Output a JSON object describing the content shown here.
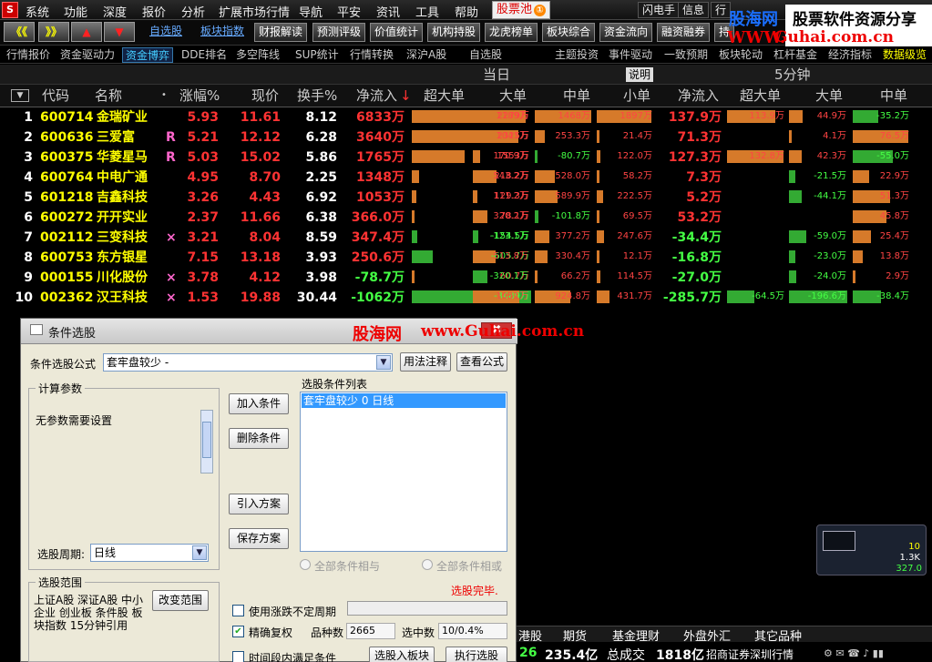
{
  "menu": {
    "logo": "S",
    "items": [
      "系统",
      "功能",
      "深度",
      "报价",
      "分析",
      "扩展市场行情",
      "导航",
      "平安",
      "资讯",
      "工具",
      "帮助"
    ],
    "pool": "股票池",
    "pool_badge": "①",
    "right": [
      "闪电手",
      "信息",
      "行"
    ]
  },
  "watermark": {
    "brand": "股海网",
    "slogan": "股票软件资源分享",
    "url": "www.Guhai.com.cn",
    "url_prefix": "WWW."
  },
  "toolbar": {
    "left_arrows": [
      "《《",
      "》》",
      "▲",
      "▼"
    ],
    "links": [
      "自选股",
      "板块指数"
    ],
    "buttons": [
      "财报解读",
      "预测评级",
      "价值统计",
      "机构持股",
      "龙虎榜单",
      "板块综合",
      "资金流向",
      "融资融券",
      "持"
    ]
  },
  "tabs": {
    "left": [
      "行情报价",
      "资金驱动力",
      "资金博弈",
      "DDE排名",
      "多空阵线",
      "SUP统计",
      "行情转换",
      "深沪A股",
      "自选股"
    ],
    "right": [
      "主题投资",
      "事件驱动",
      "一致预期",
      "板块轮动",
      "杠杆基金",
      "经济指标",
      "数据级览"
    ]
  },
  "header": {
    "group_today": "当日",
    "explain": "说明",
    "group_5min": "5分钟",
    "cols": [
      "代码",
      "名称",
      "涨幅%",
      "现价",
      "换手%",
      "净流入",
      "超大单",
      "大单",
      "中单",
      "小单",
      "净流入",
      "超大单",
      "大单",
      "中单"
    ]
  },
  "rows": [
    {
      "no": "1",
      "code": "600714",
      "name": "金瑞矿业",
      "flag": "",
      "chg": "5.93",
      "price": "11.61",
      "turn": "8.12",
      "net": "6833万",
      "xl": "2279万",
      "l": "1189万",
      "m": "1468万",
      "s": "1897万",
      "net5": "137.9万",
      "xl5": "113.9万",
      "l5": "44.9万",
      "m5": "-35.2万"
    },
    {
      "no": "2",
      "code": "600636",
      "name": "三爱富",
      "flag": "R",
      "chg": "5.21",
      "price": "12.12",
      "turn": "6.28",
      "net": "3640万",
      "xl": "2325万",
      "l": "1041万",
      "m": "253.3万",
      "s": "21.4万",
      "net5": "71.3万",
      "xl5": "",
      "l5": "4.1万",
      "m5": "76.5万"
    },
    {
      "no": "3",
      "code": "600375",
      "name": "华菱星马",
      "flag": "R",
      "chg": "5.03",
      "price": "15.02",
      "turn": "5.86",
      "net": "1765万",
      "xl": "1553万",
      "l": "170.9万",
      "m": "-80.7万",
      "s": "122.0万",
      "net5": "127.3万",
      "xl5": "132.8万",
      "l5": "42.3万",
      "m5": "-55.0万"
    },
    {
      "no": "4",
      "code": "600764",
      "name": "中电广通",
      "flag": "",
      "chg": "4.95",
      "price": "8.70",
      "turn": "2.25",
      "net": "1348万",
      "xl": "218.2万",
      "l": "543.2万",
      "m": "528.0万",
      "s": "58.2万",
      "net5": "7.3万",
      "xl5": "",
      "l5": "-21.5万",
      "m5": "22.9万"
    },
    {
      "no": "5",
      "code": "601218",
      "name": "吉鑫科技",
      "flag": "",
      "chg": "3.26",
      "price": "4.43",
      "turn": "6.92",
      "net": "1053万",
      "xl": "129.3万",
      "l": "111.2万",
      "m": "589.9万",
      "s": "222.5万",
      "net5": "5.2万",
      "xl5": "",
      "l5": "-44.1万",
      "m5": "51.3万"
    },
    {
      "no": "6",
      "code": "600272",
      "name": "开开实业",
      "flag": "",
      "chg": "2.37",
      "price": "11.66",
      "turn": "6.38",
      "net": "366.0万",
      "xl": "78.1万",
      "l": "320.2万",
      "m": "-101.8万",
      "s": "69.5万",
      "net5": "53.2万",
      "xl5": "",
      "l5": "",
      "m5": "45.8万"
    },
    {
      "no": "7",
      "code": "002112",
      "name": "三变科技",
      "flag": "×",
      "chg": "3.21",
      "price": "8.04",
      "turn": "8.59",
      "net": "347.4万",
      "xl": "-154.5万",
      "l": "-123.1万",
      "m": "377.2万",
      "s": "247.6万",
      "net5": "-34.4万",
      "xl5": "",
      "l5": "-59.0万",
      "m5": "25.4万"
    },
    {
      "no": "8",
      "code": "600753",
      "name": "东方银星",
      "flag": "",
      "chg": "7.15",
      "price": "13.18",
      "turn": "3.93",
      "net": "250.6万",
      "xl": "-605.7万",
      "l": "513.8万",
      "m": "330.4万",
      "s": "12.1万",
      "net5": "-16.8万",
      "xl5": "",
      "l5": "-23.0万",
      "m5": "13.8万"
    },
    {
      "no": "9",
      "code": "000155",
      "name": "川化股份",
      "flag": "×",
      "chg": "3.78",
      "price": "4.12",
      "turn": "3.98",
      "net": "-78.7万",
      "xl": "60.7万",
      "l": "-320.1万",
      "m": "66.2万",
      "s": "114.5万",
      "net5": "-27.0万",
      "xl5": "",
      "l5": "-24.0万",
      "m5": "2.9万"
    },
    {
      "no": "10",
      "code": "002362",
      "name": "汉王科技",
      "flag": "×",
      "chg": "1.53",
      "price": "19.88",
      "turn": "30.44",
      "net": "-1062万",
      "xl": "-3489万",
      "l": "1051万",
      "m": "924.8万",
      "s": "431.7万",
      "net5": "-285.7万",
      "xl5": "-64.5万",
      "l5": "-196.6万",
      "m5": "-38.4万"
    }
  ],
  "dialog": {
    "title": "条件选股",
    "close": "✖",
    "formula_label": "条件选股公式",
    "formula_value": "套牢盘较少 -",
    "btn_usage": "用法注释",
    "btn_view": "查看公式",
    "params_title": "计算参数",
    "params_text": "无参数需要设置",
    "btn_add": "加入条件",
    "btn_del": "删除条件",
    "btn_import": "引入方案",
    "btn_save": "保存方案",
    "list_title": "选股条件列表",
    "list_item": "套牢盘较少  0  日线",
    "radio_and": "全部条件相与",
    "radio_or": "全部条件相或",
    "period_label": "选股周期:",
    "period_value": "日线",
    "done": "选股完毕.",
    "range_title": "选股范围",
    "range_text": "上证A股 深证A股 中小企业 创业板 条件股 板块指数 15分钟引用",
    "btn_range": "改变范围",
    "chk_irregular": "使用涨跌不定周期",
    "chk_exact": "精确复权",
    "count_label": "品种数",
    "count_value": "2665",
    "hit_label": "选中数",
    "hit_value": "10/0.4%",
    "chk_time": "时间段内满足条件",
    "btn_to_board": "选股入板块",
    "btn_exec": "执行选股"
  },
  "bottom": {
    "tabs": [
      "港股",
      "期货",
      "基金理财",
      "外盘外汇",
      "其它品种"
    ],
    "num1": "26",
    "amount": "235.4亿",
    "vol_label": "总成交",
    "vol": "1818亿",
    "broker": "招商证券深圳行情"
  },
  "mini": {
    "v1": "10",
    "v2": "1.3K",
    "v3": "327.0"
  }
}
